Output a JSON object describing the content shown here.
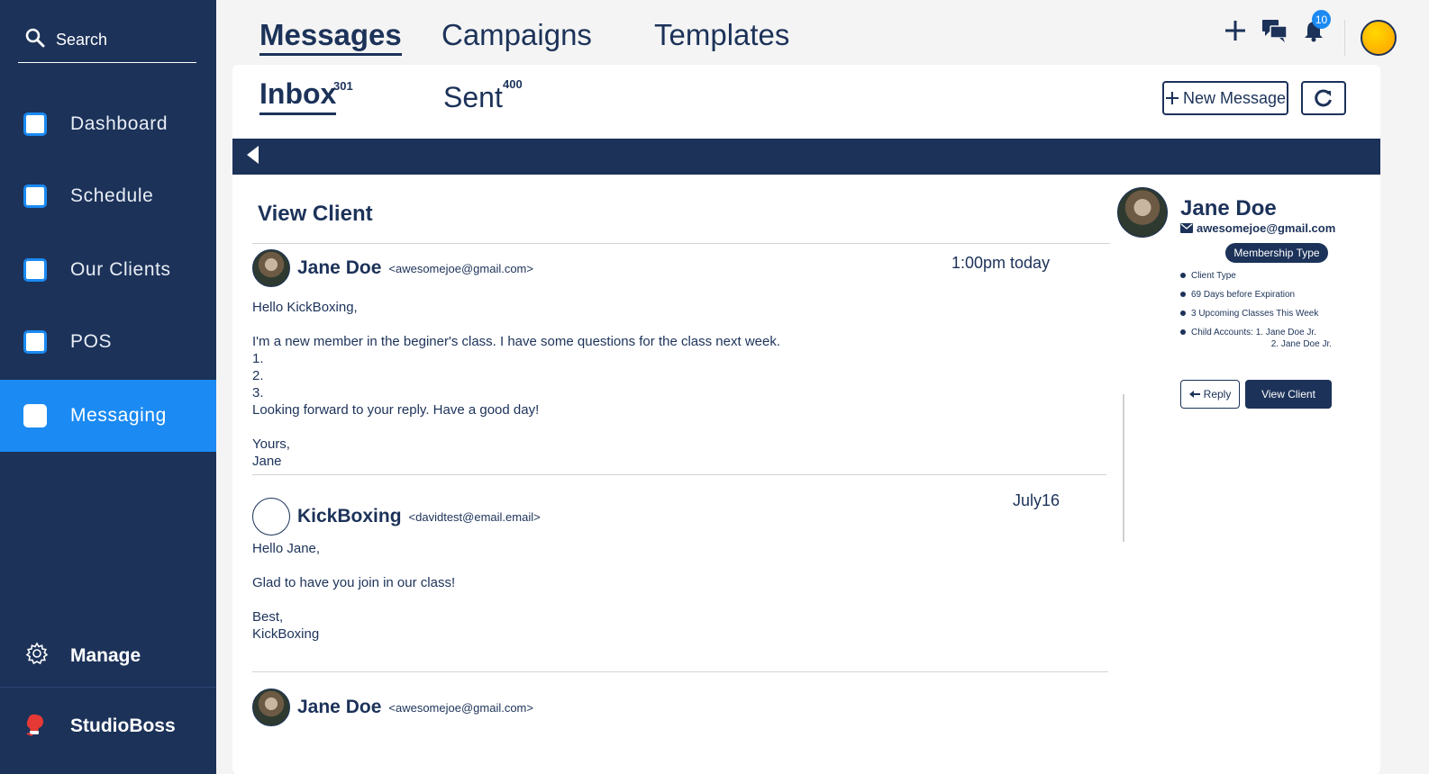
{
  "sidebar": {
    "search_label": "Search",
    "items": [
      {
        "label": "Dashboard"
      },
      {
        "label": "Schedule"
      },
      {
        "label": "Our Clients"
      },
      {
        "label": "POS"
      },
      {
        "label": "Messaging"
      }
    ],
    "manage_label": "Manage",
    "brand": "StudioBoss"
  },
  "topnav": {
    "tabs": [
      {
        "label": "Messages"
      },
      {
        "label": "Campaigns"
      },
      {
        "label": "Templates"
      }
    ],
    "notification_count": "10"
  },
  "subtabs": {
    "inbox": {
      "label": "Inbox",
      "count": "301"
    },
    "sent": {
      "label": "Sent",
      "count": "400"
    }
  },
  "actions": {
    "new_message": "New Message"
  },
  "view_title": "View Client",
  "messages": [
    {
      "sender": "Jane Doe",
      "email": "<awesomejoe@gmail.com>",
      "time": "1:00pm today",
      "body": "Hello KickBoxing,\n\nI'm a new member in the beginer's class. I have some questions for the class next week.\n1.\n2.\n3.\nLooking forward to your reply. Have a good day!\n\nYours,\nJane"
    },
    {
      "sender": "KickBoxing",
      "email": "<davidtest@email.email>",
      "time": "July16",
      "body": "Hello Jane,\n\nGlad to have you join in our class!\n\nBest,\nKickBoxing"
    },
    {
      "sender": "Jane Doe",
      "email": "<awesomejoe@gmail.com>"
    }
  ],
  "client": {
    "name": "Jane Doe",
    "email": "awesomejoe@gmail.com",
    "membership": "Membership Type",
    "details": [
      {
        "text": "Client Type"
      },
      {
        "text": "69 Days before Expiration"
      },
      {
        "text": "3 Upcoming Classes This Week"
      },
      {
        "text": "Child Accounts: 1. Jane Doe Jr.",
        "sub": "2. Jane Doe Jr."
      }
    ],
    "reply": "Reply",
    "view_client": "View Client"
  },
  "colors": {
    "navy": "#1c3259",
    "accent_blue": "#1b8af2",
    "brand_red": "#e53935"
  }
}
